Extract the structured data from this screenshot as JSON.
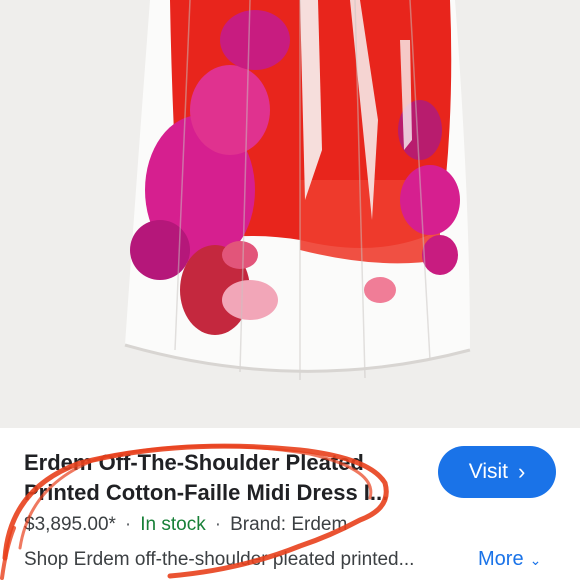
{
  "product": {
    "title": "Erdem Off-The-Shoulder Pleated Printed Cotton-Faille Midi Dress I...",
    "price": "$3,895.00*",
    "stock": "In stock",
    "separator": "·",
    "brand": "Brand: Erdem",
    "description": "Shop Erdem off-the-shoulder pleated printed..."
  },
  "actions": {
    "visit_label": "Visit",
    "more_label": "More"
  },
  "colors": {
    "accent": "#1a73e8",
    "stock_green": "#188038",
    "scribble": "#e8401c",
    "dress_red": "#e8251c",
    "dress_magenta": "#d61f8f"
  }
}
